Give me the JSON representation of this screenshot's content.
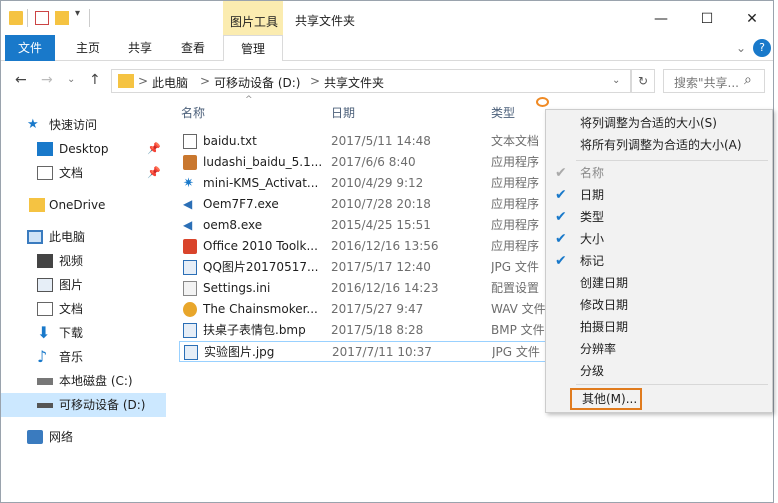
{
  "window": {
    "title": "共享文件夹",
    "context_tab_group": "图片工具",
    "buttons": {
      "minimize": "—",
      "maximize": "☐",
      "close": "✕"
    }
  },
  "ribbon": {
    "tabs": [
      "文件",
      "主页",
      "共享",
      "查看",
      "管理"
    ],
    "expand": "⌄",
    "help": "?"
  },
  "address": {
    "back": "←",
    "forward": "→",
    "recent": "⌄",
    "up": "↑",
    "crumbs": [
      "此电脑",
      "可移动设备 (D:)",
      "共享文件夹"
    ],
    "separator": ">",
    "dropdown": "⌄",
    "refresh": "↻",
    "search_placeholder": "搜索\"共享...",
    "search_icon": "⌕"
  },
  "nav": {
    "items": [
      {
        "label": "快速访问",
        "icon": "star-icon"
      },
      {
        "label": "Desktop",
        "icon": "desktop-icon",
        "pinned": true
      },
      {
        "label": "文档",
        "icon": "document-icon",
        "pinned": true
      },
      {
        "label": "OneDrive",
        "icon": "folder-icon"
      },
      {
        "label": "此电脑",
        "icon": "computer-icon"
      },
      {
        "label": "视频",
        "icon": "video-icon"
      },
      {
        "label": "图片",
        "icon": "picture-icon"
      },
      {
        "label": "文档",
        "icon": "document-icon"
      },
      {
        "label": "下载",
        "icon": "download-icon"
      },
      {
        "label": "音乐",
        "icon": "music-icon"
      },
      {
        "label": "本地磁盘 (C:)",
        "icon": "drive-icon"
      },
      {
        "label": "可移动设备 (D:)",
        "icon": "removable-drive-icon",
        "selected": true
      },
      {
        "label": "网络",
        "icon": "network-icon"
      }
    ],
    "pin_glyph": "📌"
  },
  "columns": {
    "name": "名称",
    "date": "日期",
    "type": "类型",
    "sort_arrow": "^"
  },
  "files": [
    {
      "name": "baidu.txt",
      "date": "2017/5/11 14:48",
      "type": "文本文档",
      "icon": "text-file-icon"
    },
    {
      "name": "ludashi_baidu_5.1...",
      "date": "2017/6/6 8:40",
      "type": "应用程序",
      "icon": "app-icon"
    },
    {
      "name": "mini-KMS_Activat...",
      "date": "2010/4/29 9:12",
      "type": "应用程序",
      "icon": "kms-icon"
    },
    {
      "name": "Oem7F7.exe",
      "date": "2010/7/28 20:18",
      "type": "应用程序",
      "icon": "exe-icon"
    },
    {
      "name": "oem8.exe",
      "date": "2015/4/25 15:51",
      "type": "应用程序",
      "icon": "exe-icon"
    },
    {
      "name": "Office 2010 Toolk...",
      "date": "2016/12/16 13:56",
      "type": "应用程序",
      "icon": "office-icon"
    },
    {
      "name": "QQ图片20170517...",
      "date": "2017/5/17 12:40",
      "type": "JPG 文件",
      "icon": "image-file-icon"
    },
    {
      "name": "Settings.ini",
      "date": "2016/12/16 14:23",
      "type": "配置设置",
      "icon": "settings-file-icon"
    },
    {
      "name": "The Chainsmoker...",
      "date": "2017/5/27 9:47",
      "type": "WAV 文件",
      "icon": "audio-file-icon"
    },
    {
      "name": "扶桌子表情包.bmp",
      "date": "2017/5/18 8:28",
      "type": "BMP 文件",
      "icon": "image-file-icon"
    },
    {
      "name": "实验图片.jpg",
      "date": "2017/7/11 10:37",
      "type": "JPG 文件",
      "icon": "image-file-icon",
      "selected": true
    }
  ],
  "menu": {
    "top": [
      "将列调整为合适的大小(S)",
      "将所有列调整为合适的大小(A)"
    ],
    "items": [
      {
        "label": "名称",
        "checked": true,
        "disabled": true
      },
      {
        "label": "日期",
        "checked": true
      },
      {
        "label": "类型",
        "checked": true
      },
      {
        "label": "大小",
        "checked": true
      },
      {
        "label": "标记",
        "checked": true
      },
      {
        "label": "创建日期",
        "checked": false
      },
      {
        "label": "修改日期",
        "checked": false
      },
      {
        "label": "拍摄日期",
        "checked": false
      },
      {
        "label": "分辨率",
        "checked": false
      },
      {
        "label": "分级",
        "checked": false
      }
    ],
    "more": "其他(M)...",
    "check_glyph": "✔"
  },
  "colors": {
    "accent": "#1979ca",
    "context_tab": "#fbecb0",
    "highlight": "#e07b1e",
    "selected_nav": "#cce8ff"
  }
}
